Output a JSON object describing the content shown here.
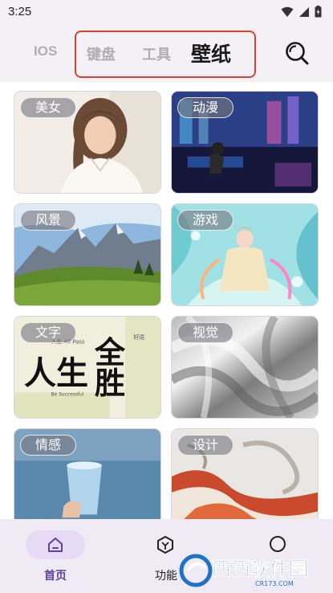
{
  "status": {
    "time": "3:25"
  },
  "header": {
    "tabs": {
      "ios": "IOS",
      "keyboard": "键盘",
      "tools": "工具",
      "wallpaper": "壁纸"
    },
    "search_icon": "search-icon",
    "accent_box_color": "#d8432f"
  },
  "categories": [
    {
      "label": "美女"
    },
    {
      "label": "动漫"
    },
    {
      "label": "风景"
    },
    {
      "label": "游戏"
    },
    {
      "label": "文字"
    },
    {
      "label": "视觉"
    },
    {
      "label": "情感"
    },
    {
      "label": "设计"
    }
  ],
  "thumbnail_text": {
    "line1": "人生",
    "line2": "全胜"
  },
  "bottom_nav": {
    "items": [
      {
        "label": "首页",
        "icon": "home-icon",
        "active": true
      },
      {
        "label": "功能",
        "icon": "hexagon-icon",
        "active": false
      },
      {
        "label": "",
        "icon": "circle-icon",
        "active": false
      }
    ],
    "active_color": "#5e3fa3"
  },
  "watermark": {
    "text": "西西软件园",
    "subtext": "CR173.COM"
  }
}
